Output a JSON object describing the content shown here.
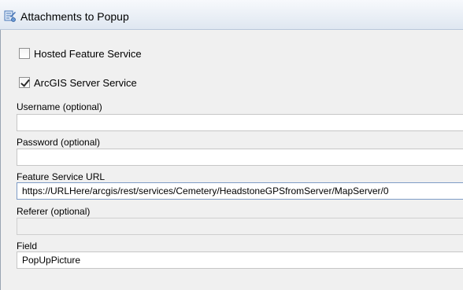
{
  "window": {
    "title": "Attachments to Popup",
    "icon": "tool-icon"
  },
  "options": {
    "hosted_feature_service": {
      "label": "Hosted Feature Service",
      "checked": false
    },
    "arcgis_server_service": {
      "label": "ArcGIS Server Service",
      "checked": true
    }
  },
  "fields": {
    "username": {
      "label": "Username (optional)",
      "value": ""
    },
    "password": {
      "label": "Password (optional)",
      "value": ""
    },
    "feature_service_url": {
      "label": "Feature Service URL",
      "value": "https://URLHere/arcgis/rest/services/Cemetery/HeadstoneGPSfromServer/MapServer/0"
    },
    "referer": {
      "label": "Referer (optional)",
      "value": ""
    },
    "field": {
      "label": "Field",
      "value": "PopUpPicture"
    }
  }
}
